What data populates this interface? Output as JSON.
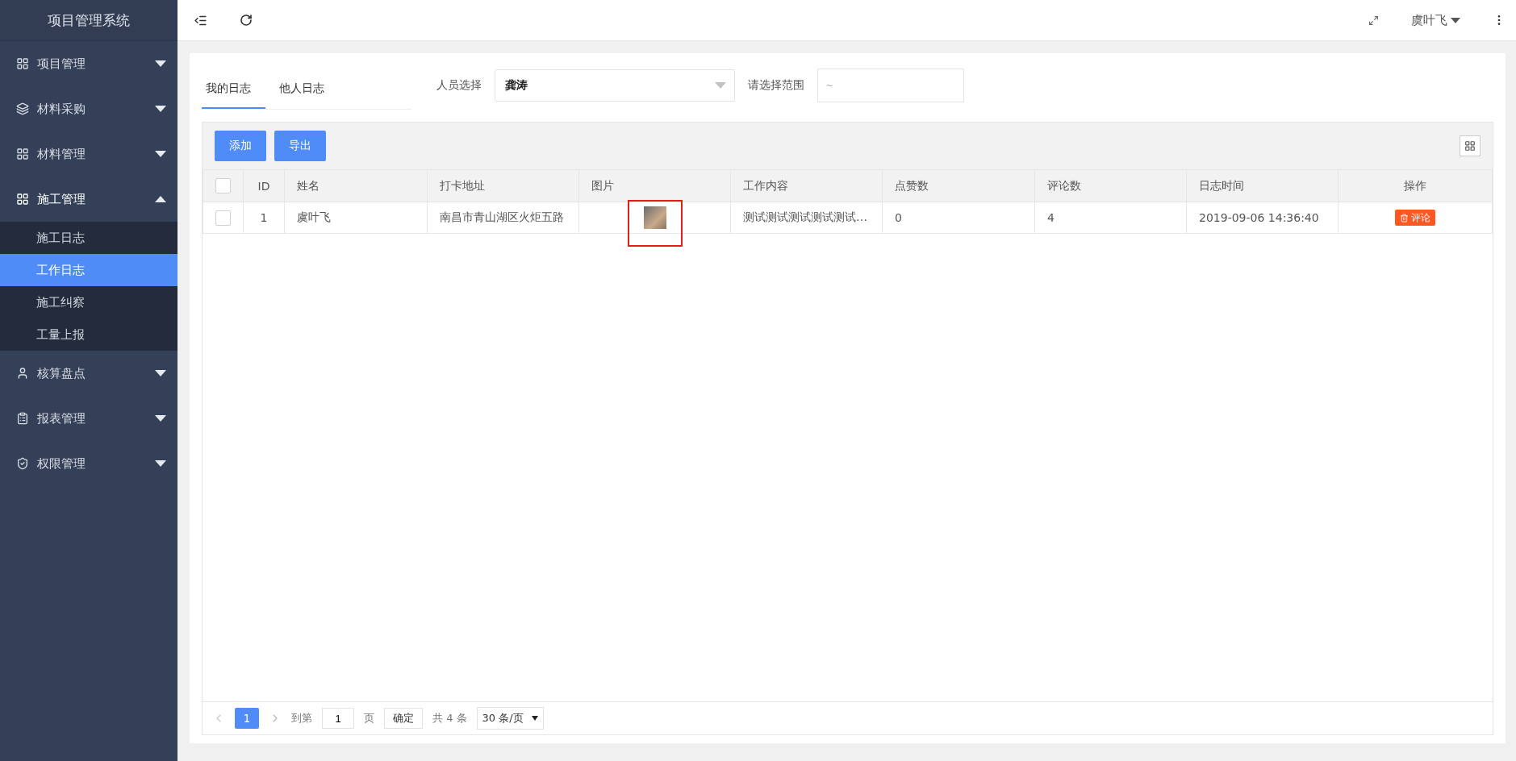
{
  "sidebar": {
    "title": "项目管理系统",
    "items": [
      {
        "label": "项目管理",
        "expanded": false
      },
      {
        "label": "材料采购",
        "expanded": false
      },
      {
        "label": "材料管理",
        "expanded": false
      },
      {
        "label": "施工管理",
        "expanded": true,
        "children": [
          {
            "label": "施工日志",
            "selected": false
          },
          {
            "label": "工作日志",
            "selected": true
          },
          {
            "label": "施工纠察",
            "selected": false
          },
          {
            "label": "工量上报",
            "selected": false
          }
        ]
      },
      {
        "label": "核算盘点",
        "expanded": false
      },
      {
        "label": "报表管理",
        "expanded": false
      },
      {
        "label": "权限管理",
        "expanded": false
      }
    ]
  },
  "topbar": {
    "user": "虞叶飞"
  },
  "tabs": [
    {
      "label": "我的日志",
      "selected": true
    },
    {
      "label": "他人日志",
      "selected": false
    }
  ],
  "filters": {
    "person_label": "人员选择",
    "person_value": "龚涛",
    "range_label": "请选择范围",
    "range_placeholder": "~"
  },
  "toolbar": {
    "buttons": [
      "添加",
      "导出"
    ]
  },
  "table": {
    "all_checked": false,
    "columns": [
      "ID",
      "姓名",
      "打卡地址",
      "图片",
      "工作内容",
      "点赞数",
      "评论数",
      "日志时间",
      "操作"
    ],
    "rows": [
      {
        "checked": false,
        "id": "1",
        "name": "虞叶飞",
        "address": "南昌市青山湖区火炬五路",
        "content": "测试测试测试测试测试…",
        "likes": "0",
        "comments": "4",
        "time": "2019-09-06 14:36:40",
        "action": "评论"
      }
    ]
  },
  "pagination": {
    "pages": [
      {
        "label": "1",
        "selected": true
      }
    ],
    "goto_label": "到第",
    "goto_value": "1",
    "page_unit": "页",
    "confirm": "确定",
    "total": "共 4 条",
    "page_size": "30 条/页"
  }
}
